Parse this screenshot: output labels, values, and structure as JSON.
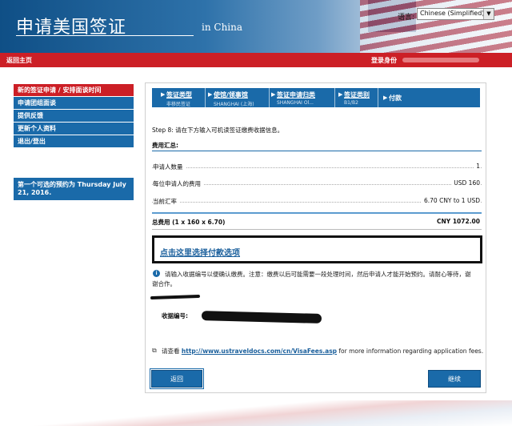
{
  "header": {
    "title_cn": "申请美国签证",
    "title_en": "in China",
    "language_label": "语言:",
    "language_value": "Chinese (Simplified)"
  },
  "topnav": {
    "home": "返回主页",
    "login_as": "登录身份"
  },
  "sidebar": {
    "items": [
      {
        "label": "新的签证申请 / 安排面谈时间"
      },
      {
        "label": "申请团组面谈"
      },
      {
        "label": "提供反馈"
      },
      {
        "label": "更新个人资料"
      },
      {
        "label": "退出/登出"
      }
    ],
    "promo": "第一个可选的预约为 Thursday July 21, 2016."
  },
  "steps": [
    {
      "name": "签证类型",
      "sub": "非移民签证"
    },
    {
      "name": "使馆/领事馆",
      "sub": "SHANGHAI (上海)"
    },
    {
      "name": "签证申请归类",
      "sub": "SHANGHAI Ol..."
    },
    {
      "name": "签证类别",
      "sub": "B1/B2"
    },
    {
      "name": "付款",
      "sub": ""
    }
  ],
  "content": {
    "step_desc": "Step 8: 请在下方输入可机读签证缴费收据信息。",
    "fees_heading": "费用汇总:",
    "fees": [
      {
        "label": "申请人数量",
        "value": "1"
      },
      {
        "label": "每位申请人的费用",
        "value": "USD 160"
      },
      {
        "label": "当前汇率",
        "value": "6.70 CNY to 1 USD"
      }
    ],
    "total_label": "总费用 (1 x 160 x 6.70)",
    "total_value": "CNY 1072.00",
    "pay_link": "点击这里选择付款选项",
    "info_icon": "i",
    "info": "请输入收据编号以便确认缴费。注意：缴费以后可能需要一段处理时间，然后申请人才能开始预约。请耐心等待，谢谢合作。",
    "receipt_label": "收据编号:",
    "note_prefix": "请查看",
    "note_link": "http://www.ustraveldocs.com/cn/VisaFees.asp",
    "note_suffix": "for more information regarding application fees."
  },
  "buttons": {
    "back": "返回",
    "next": "继续"
  }
}
